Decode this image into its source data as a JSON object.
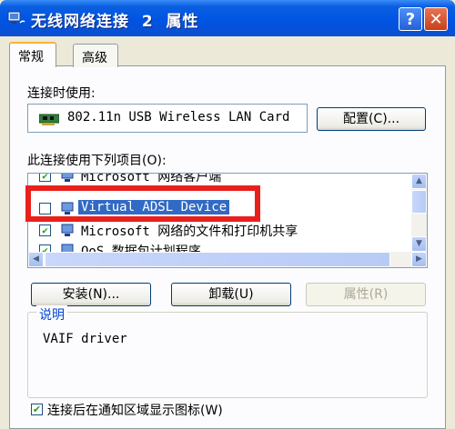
{
  "window": {
    "title": "无线网络连接  2  属性",
    "help_label": "?",
    "close_label": "✕"
  },
  "tabs": [
    {
      "label": "常规",
      "active": true
    },
    {
      "label": "高级",
      "active": false
    }
  ],
  "connect_using": {
    "label": "连接时使用:",
    "device": "802.11n USB Wireless LAN Card",
    "configure_button": "配置(C)..."
  },
  "components": {
    "label": "此连接使用下列项目(O):",
    "items": [
      {
        "name": "Microsoft 网络客户端",
        "checked": true,
        "selected": false
      },
      {
        "name": "Virtual ADSL Device",
        "checked": false,
        "selected": true
      },
      {
        "name": "Microsoft 网络的文件和打印机共享",
        "checked": true,
        "selected": false
      },
      {
        "name": "QoS 数据包计划程序",
        "checked": true,
        "selected": false
      }
    ]
  },
  "buttons": {
    "install": "安装(N)...",
    "uninstall": "卸载(U)",
    "properties": "属性(R)"
  },
  "description": {
    "title": "说明",
    "text": "VAIF driver"
  },
  "show_icon_option": {
    "label": "连接后在通知区域显示图标(W)",
    "checked": true
  },
  "colors": {
    "title_bar": "#0054e3",
    "selection": "#316ac5",
    "highlight_box": "#e8201c",
    "group_title": "#0046d5"
  }
}
